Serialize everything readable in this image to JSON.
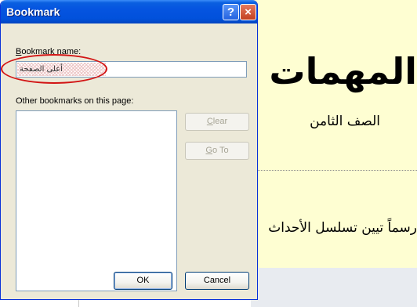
{
  "document": {
    "title": "المهمات",
    "subtitle": "الصف الثامن",
    "body_text": "رسماً تيين تسلسل الأحداث"
  },
  "dialog": {
    "title": "Bookmark",
    "help_glyph": "?",
    "close_glyph": "×",
    "bookmark_name_label_mnemonic": "B",
    "bookmark_name_label_rest": "ookmark name:",
    "bookmark_name_value": "أعلى الصفحة",
    "other_bookmarks_label": "Other bookmarks on this page:",
    "other_bookmarks_items": [],
    "clear_mnemonic": "C",
    "clear_rest": "lear",
    "goto_mnemonic": "G",
    "goto_rest": "o To",
    "ok_label": "OK",
    "cancel_label": "Cancel"
  },
  "icons": {
    "help": "help-icon",
    "close": "close-icon"
  },
  "colors": {
    "titlebar": "#0554e0",
    "dialog_bg": "#ece9d8",
    "document_bg": "#fefed2",
    "annotation": "#d21414"
  }
}
